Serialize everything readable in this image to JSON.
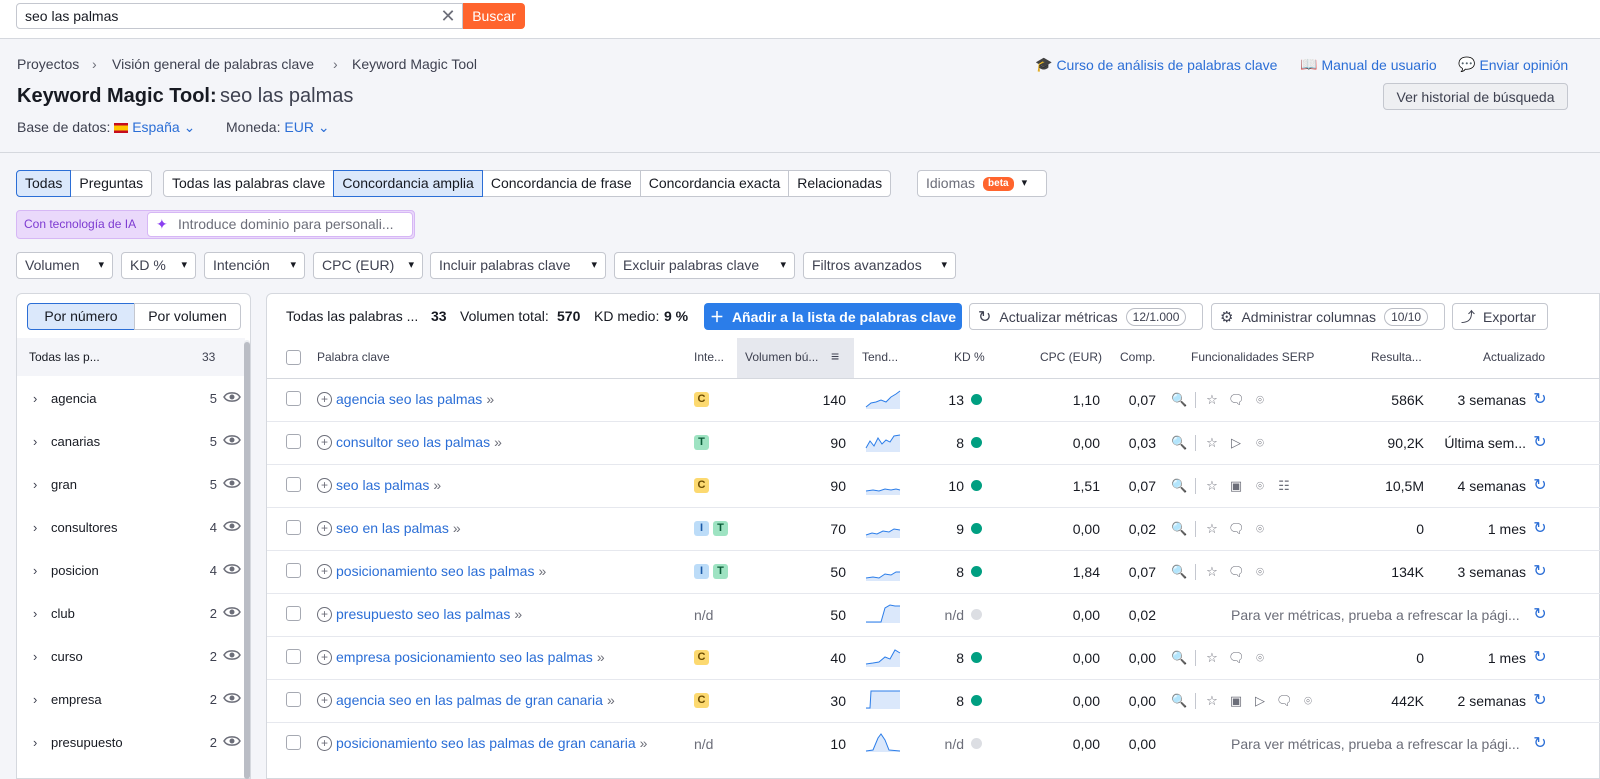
{
  "search": {
    "value": "seo las palmas",
    "button": "Buscar"
  },
  "breadcrumb": [
    "Proyectos",
    "Visión general de palabras clave",
    "Keyword Magic Tool"
  ],
  "toplinks": {
    "course": "Curso de análisis de palabras clave",
    "manual": "Manual de usuario",
    "feedback": "Enviar opinión"
  },
  "header": {
    "title": "Keyword Magic Tool:",
    "query": "seo las palmas",
    "history_button": "Ver historial de búsqueda"
  },
  "meta": {
    "db_label": "Base de datos:",
    "db_value": "España",
    "currency_label": "Moneda:",
    "currency_value": "EUR"
  },
  "match_tabs": {
    "a1": "Todas",
    "a2": "Preguntas",
    "b1": "Todas las palabras clave",
    "b2": "Concordancia amplia",
    "b3": "Concordancia de frase",
    "b4": "Concordancia exacta",
    "b5": "Relacionadas",
    "lang": "Idiomas",
    "beta": "beta"
  },
  "ai": {
    "label": "Con tecnología de IA",
    "placeholder": "Introduce dominio para personali..."
  },
  "filters": [
    "Volumen",
    "KD %",
    "Intención",
    "CPC (EUR)",
    "Incluir palabras clave",
    "Excluir palabras clave",
    "Filtros avanzados"
  ],
  "left": {
    "seg_a": "Por número",
    "seg_b": "Por volumen",
    "header_label": "Todas las p...",
    "header_count": "33",
    "groups": [
      {
        "name": "agencia",
        "count": "5"
      },
      {
        "name": "canarias",
        "count": "5"
      },
      {
        "name": "gran",
        "count": "5"
      },
      {
        "name": "consultores",
        "count": "4"
      },
      {
        "name": "posicion",
        "count": "4"
      },
      {
        "name": "club",
        "count": "2"
      },
      {
        "name": "curso",
        "count": "2"
      },
      {
        "name": "empresa",
        "count": "2"
      },
      {
        "name": "presupuesto",
        "count": "2"
      }
    ]
  },
  "summary": {
    "label": "Todas las palabras ...",
    "count": "33",
    "vol_label": "Volumen total:",
    "vol_value": "570",
    "kd_label": "KD medio:",
    "kd_value": "9 %"
  },
  "actions": {
    "add": "Añadir a la lista de palabras clave",
    "update": "Actualizar métricas",
    "update_pill": "12/1.000",
    "columns": "Administrar columnas",
    "columns_pill": "10/10",
    "export": "Exportar"
  },
  "columns": {
    "kw": "Palabra clave",
    "intent": "Inte...",
    "volume": "Volumen bú...",
    "trend": "Tend...",
    "kd": "KD %",
    "cpc": "CPC (EUR)",
    "comp": "Comp.",
    "serp": "Funcionalidades SERP",
    "results": "Resulta...",
    "updated": "Actualizado"
  },
  "rows": [
    {
      "kw": "agencia seo las palmas",
      "intent": [
        "C"
      ],
      "volume": "140",
      "kd": "13",
      "cpc": "1,10",
      "comp": "0,07",
      "results": "586K",
      "updated": "3 semanas"
    },
    {
      "kw": "consultor seo las palmas",
      "intent": [
        "T"
      ],
      "volume": "90",
      "kd": "8",
      "cpc": "0,00",
      "comp": "0,03",
      "results": "90,2K",
      "updated": "Última sem..."
    },
    {
      "kw": "seo las palmas",
      "intent": [
        "C"
      ],
      "volume": "90",
      "kd": "10",
      "cpc": "1,51",
      "comp": "0,07",
      "results": "10,5M",
      "updated": "4 semanas"
    },
    {
      "kw": "seo en las palmas",
      "intent": [
        "I",
        "T"
      ],
      "volume": "70",
      "kd": "9",
      "cpc": "0,00",
      "comp": "0,02",
      "results": "0",
      "updated": "1 mes"
    },
    {
      "kw": "posicionamiento seo las palmas",
      "intent": [
        "I",
        "T"
      ],
      "volume": "50",
      "kd": "8",
      "cpc": "1,84",
      "comp": "0,07",
      "results": "134K",
      "updated": "3 semanas"
    },
    {
      "kw": "presupuesto seo las palmas",
      "intent": [],
      "intent_na": "n/d",
      "volume": "50",
      "kd": "n/d",
      "cpc": "0,00",
      "comp": "0,02",
      "message": "Para ver métricas, prueba a refrescar la pági..."
    },
    {
      "kw": "empresa posicionamiento seo las palmas",
      "intent": [
        "C"
      ],
      "volume": "40",
      "kd": "8",
      "cpc": "0,00",
      "comp": "0,00",
      "results": "0",
      "updated": "1 mes"
    },
    {
      "kw": "agencia seo en las palmas de gran canaria",
      "intent": [
        "C"
      ],
      "volume": "30",
      "kd": "8",
      "cpc": "0,00",
      "comp": "0,00",
      "results": "442K",
      "updated": "2 semanas"
    },
    {
      "kw": "posicionamiento seo las palmas de gran canaria",
      "intent": [],
      "intent_na": "n/d",
      "volume": "10",
      "kd": "n/d",
      "cpc": "0,00",
      "comp": "0,00",
      "message": "Para ver métricas, prueba a refrescar la pági..."
    }
  ],
  "colors": {
    "accent": "#2b7de9",
    "brand": "#ff642d",
    "kd_green": "#009f81",
    "link": "#2b6ed6"
  }
}
